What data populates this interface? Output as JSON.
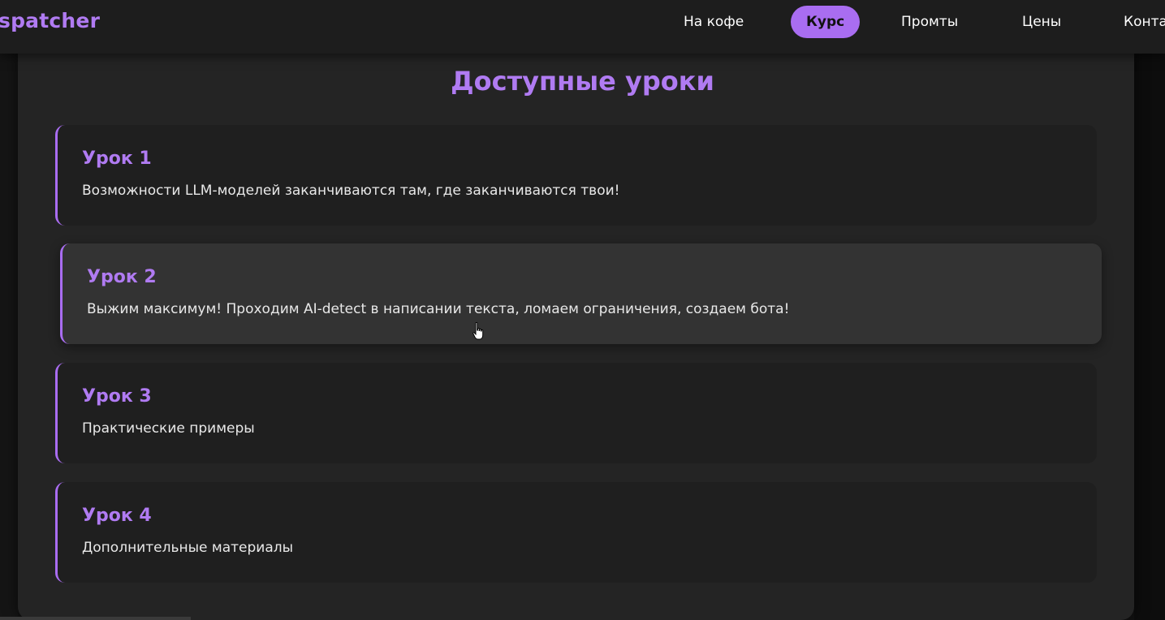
{
  "navbar": {
    "brand": "spatcher",
    "items": [
      {
        "label": "На кофе",
        "active": false
      },
      {
        "label": "Курс",
        "active": true
      },
      {
        "label": "Промты",
        "active": false
      },
      {
        "label": "Цены",
        "active": false
      },
      {
        "label": "Конта",
        "active": false
      }
    ]
  },
  "main": {
    "title": "Доступные уроки",
    "lessons": [
      {
        "title": "Урок 1",
        "description": "Возможности LLM-моделей заканчиваются там, где заканчиваются твои!"
      },
      {
        "title": "Урок 2",
        "description": "Выжим максимум! Проходим AI-detect в написании текста, ломаем ограничения, создаем бота!"
      },
      {
        "title": "Урок 3",
        "description": "Практические примеры"
      },
      {
        "title": "Урок 4",
        "description": "Дополнительные материалы"
      }
    ]
  },
  "colors": {
    "accent": "#a96df1",
    "accent_text": "#b07bf2",
    "background": "#242424",
    "card": "#1f1f1f",
    "card_hover": "#333333"
  }
}
